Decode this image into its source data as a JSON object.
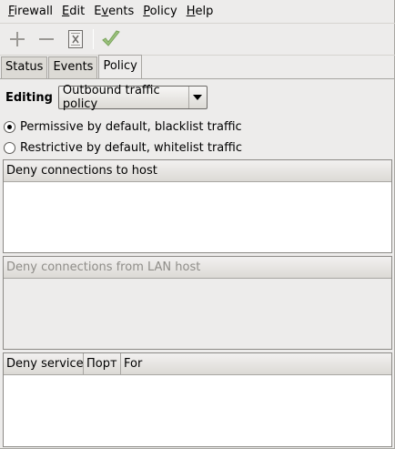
{
  "menubar": {
    "items": [
      {
        "pre": "",
        "u": "F",
        "post": "irewall"
      },
      {
        "pre": "",
        "u": "E",
        "post": "dit"
      },
      {
        "pre": "E",
        "u": "v",
        "post": "ents"
      },
      {
        "pre": "",
        "u": "P",
        "post": "olicy"
      },
      {
        "pre": "",
        "u": "H",
        "post": "elp"
      }
    ]
  },
  "toolbar": {
    "icons": [
      "add-icon",
      "remove-icon",
      "clear-icon",
      "apply-icon"
    ],
    "colors": {
      "disabled": "#9a9894",
      "apply": "#79a35b"
    }
  },
  "tabs": [
    "Status",
    "Events",
    "Policy"
  ],
  "active_tab": "Policy",
  "editing": {
    "label": "Editing",
    "selected": "Outbound traffic policy"
  },
  "policy": {
    "permissive_label": "Permissive by default, blacklist traffic",
    "restrictive_label": "Restrictive by default, whitelist traffic",
    "selected": "permissive"
  },
  "lists": {
    "deny_host": {
      "header": "Deny connections to host"
    },
    "deny_lan": {
      "header": "Deny connections from LAN host"
    },
    "deny_service": {
      "headers": [
        "Deny service",
        "Порт",
        "For"
      ]
    }
  }
}
